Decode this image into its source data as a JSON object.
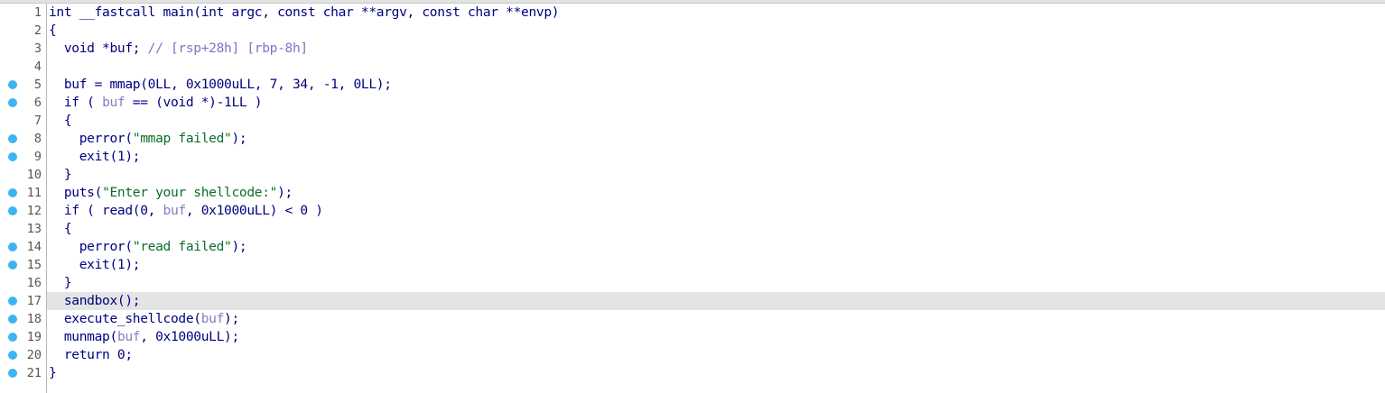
{
  "editor": {
    "lines": [
      {
        "num": "1",
        "breakpoint": false,
        "highlight": false,
        "tokens": [
          {
            "t": "int __fastcall main(int argc, const char **argv, const char **envp)",
            "c": "kw"
          }
        ]
      },
      {
        "num": "2",
        "breakpoint": false,
        "highlight": false,
        "tokens": [
          {
            "t": "{",
            "c": "kw"
          }
        ]
      },
      {
        "num": "3",
        "breakpoint": false,
        "highlight": false,
        "tokens": [
          {
            "t": "  void *buf; ",
            "c": "kw"
          },
          {
            "t": "// [rsp+28h] [rbp-8h]",
            "c": "cmt"
          }
        ]
      },
      {
        "num": "4",
        "breakpoint": false,
        "highlight": false,
        "tokens": []
      },
      {
        "num": "5",
        "breakpoint": true,
        "highlight": false,
        "tokens": [
          {
            "t": "  buf = mmap(0LL, 0x1000uLL, 7, 34, -1, 0LL);",
            "c": "kw"
          }
        ]
      },
      {
        "num": "6",
        "breakpoint": true,
        "highlight": false,
        "tokens": [
          {
            "t": "  if ( ",
            "c": "kw"
          },
          {
            "t": "buf",
            "c": "var"
          },
          {
            "t": " == (void *)-1LL )",
            "c": "kw"
          }
        ]
      },
      {
        "num": "7",
        "breakpoint": false,
        "highlight": false,
        "tokens": [
          {
            "t": "  {",
            "c": "kw"
          }
        ]
      },
      {
        "num": "8",
        "breakpoint": true,
        "highlight": false,
        "tokens": [
          {
            "t": "    perror(",
            "c": "kw"
          },
          {
            "t": "\"mmap failed\"",
            "c": "str"
          },
          {
            "t": ");",
            "c": "kw"
          }
        ]
      },
      {
        "num": "9",
        "breakpoint": true,
        "highlight": false,
        "tokens": [
          {
            "t": "    exit(1);",
            "c": "kw"
          }
        ]
      },
      {
        "num": "10",
        "breakpoint": false,
        "highlight": false,
        "tokens": [
          {
            "t": "  }",
            "c": "kw"
          }
        ]
      },
      {
        "num": "11",
        "breakpoint": true,
        "highlight": false,
        "tokens": [
          {
            "t": "  puts(",
            "c": "kw"
          },
          {
            "t": "\"Enter your shellcode:\"",
            "c": "str"
          },
          {
            "t": ");",
            "c": "kw"
          }
        ]
      },
      {
        "num": "12",
        "breakpoint": true,
        "highlight": false,
        "tokens": [
          {
            "t": "  if ( read(0, ",
            "c": "kw"
          },
          {
            "t": "buf",
            "c": "var"
          },
          {
            "t": ", 0x1000uLL) < 0 )",
            "c": "kw"
          }
        ]
      },
      {
        "num": "13",
        "breakpoint": false,
        "highlight": false,
        "tokens": [
          {
            "t": "  {",
            "c": "kw"
          }
        ]
      },
      {
        "num": "14",
        "breakpoint": true,
        "highlight": false,
        "tokens": [
          {
            "t": "    perror(",
            "c": "kw"
          },
          {
            "t": "\"read failed\"",
            "c": "str"
          },
          {
            "t": ");",
            "c": "kw"
          }
        ]
      },
      {
        "num": "15",
        "breakpoint": true,
        "highlight": false,
        "tokens": [
          {
            "t": "    exit(1);",
            "c": "kw"
          }
        ]
      },
      {
        "num": "16",
        "breakpoint": false,
        "highlight": false,
        "tokens": [
          {
            "t": "  }",
            "c": "kw"
          }
        ]
      },
      {
        "num": "17",
        "breakpoint": true,
        "highlight": true,
        "tokens": [
          {
            "t": "  sandbox();",
            "c": "kw"
          }
        ]
      },
      {
        "num": "18",
        "breakpoint": true,
        "highlight": false,
        "tokens": [
          {
            "t": "  execute_shellcode(",
            "c": "kw"
          },
          {
            "t": "buf",
            "c": "var"
          },
          {
            "t": ");",
            "c": "kw"
          }
        ]
      },
      {
        "num": "19",
        "breakpoint": true,
        "highlight": false,
        "tokens": [
          {
            "t": "  munmap(",
            "c": "kw"
          },
          {
            "t": "buf",
            "c": "var"
          },
          {
            "t": ", 0x1000uLL);",
            "c": "kw"
          }
        ]
      },
      {
        "num": "20",
        "breakpoint": true,
        "highlight": false,
        "tokens": [
          {
            "t": "  return 0;",
            "c": "kw"
          }
        ]
      },
      {
        "num": "21",
        "breakpoint": true,
        "highlight": false,
        "tokens": [
          {
            "t": "}",
            "c": "kw"
          }
        ]
      }
    ]
  },
  "colors": {
    "keyword": "#000080",
    "variable": "#8080c0",
    "string": "#0b6e2c",
    "comment": "#7878c8",
    "breakpoint": "#3db4f2",
    "highlight_line": "#e4e4e4"
  },
  "icons": {
    "breakpoint": "breakpoint-dot-icon"
  }
}
